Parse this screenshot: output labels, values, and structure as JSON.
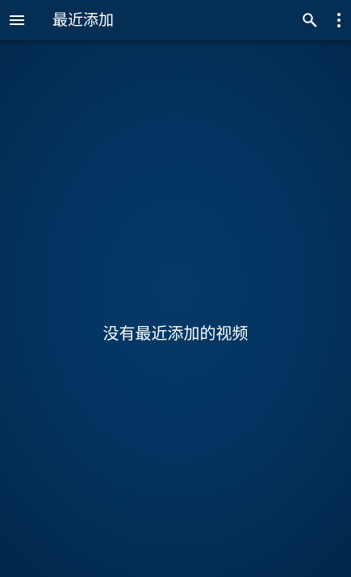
{
  "toolbar": {
    "title": "最近添加",
    "menu_icon": "menu-icon",
    "search_icon": "search-icon",
    "more_icon": "more-vertical-icon"
  },
  "content": {
    "empty_message": "没有最近添加的视频"
  },
  "colors": {
    "toolbar_background": "#052e55",
    "background_center": "#053a66",
    "background_edge": "#02284c",
    "text": "#ffffff"
  }
}
